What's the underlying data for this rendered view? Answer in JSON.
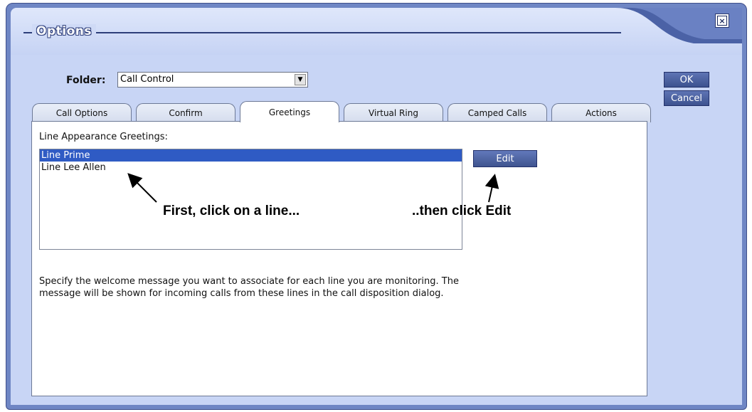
{
  "window": {
    "title": "Options",
    "close_glyph": "×"
  },
  "folder": {
    "label": "Folder:",
    "value": "Call Control"
  },
  "buttons": {
    "ok": "OK",
    "cancel": "Cancel",
    "edit": "Edit"
  },
  "tabs": [
    {
      "label": "Call Options"
    },
    {
      "label": "Confirm"
    },
    {
      "label": "Greetings",
      "active": true
    },
    {
      "label": "Virtual Ring"
    },
    {
      "label": "Camped Calls"
    },
    {
      "label": "Actions"
    }
  ],
  "greetings": {
    "label": "Line Appearance Greetings:",
    "lines": [
      "Line Prime",
      "Line Lee Allen"
    ],
    "selected_index": 0,
    "description": "Specify the welcome message you want to associate for each line you are monitoring. The message will be shown for incoming calls from these lines in the call disposition dialog."
  },
  "annotations": {
    "first": "First, click on a line...",
    "then": "..then click Edit"
  }
}
